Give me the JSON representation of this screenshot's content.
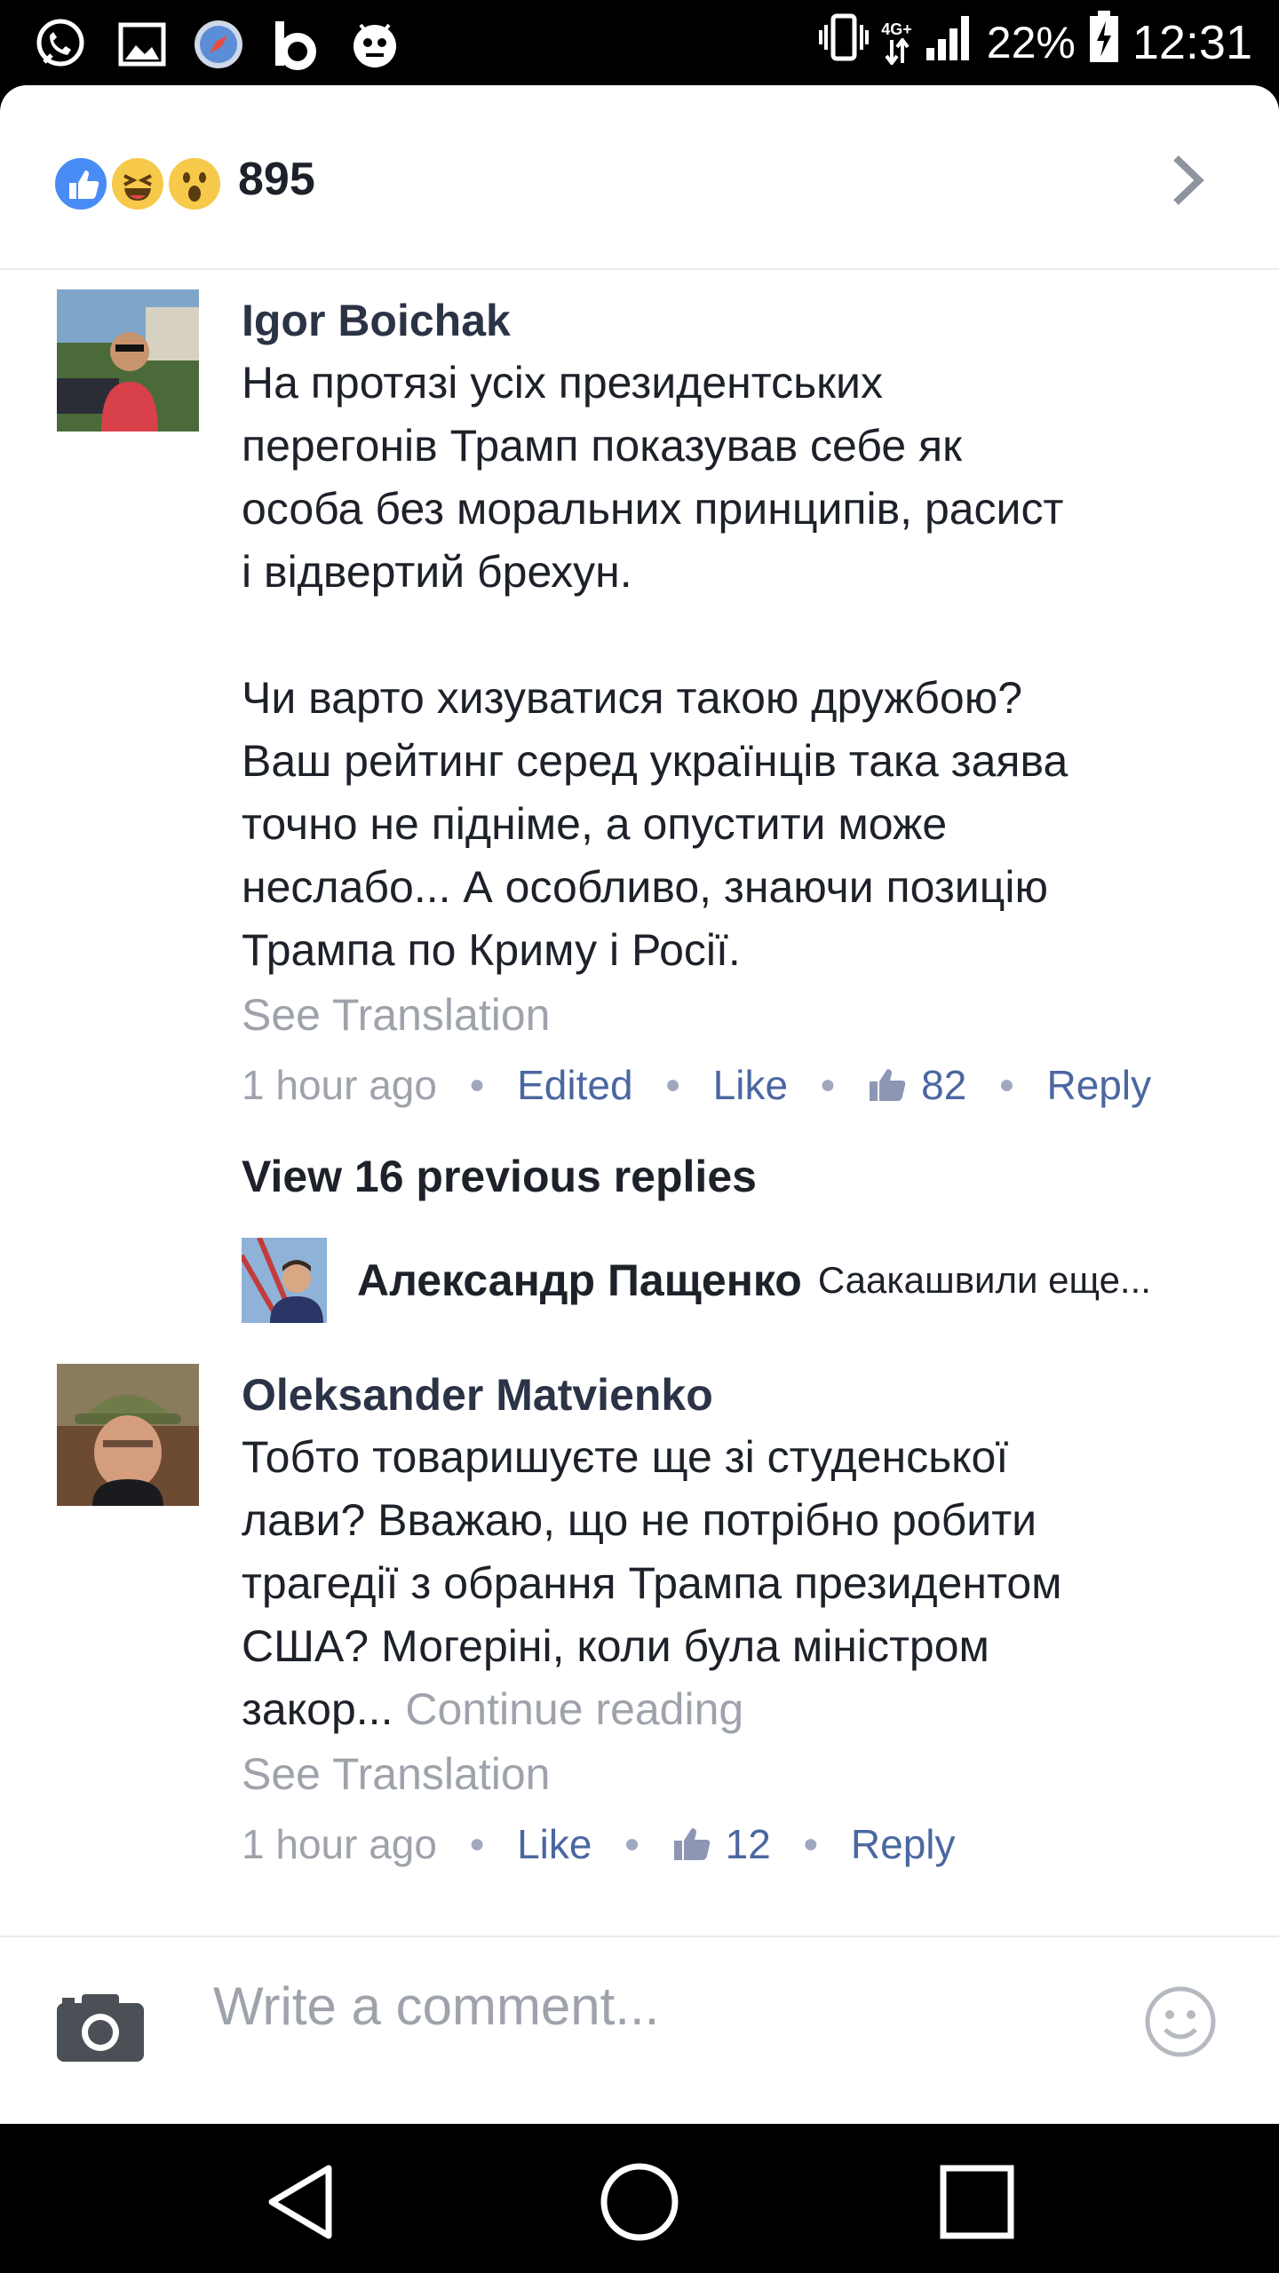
{
  "status_bar": {
    "icons": [
      "viber-icon",
      "gallery-icon",
      "browser-compass-icon",
      "b-app-icon",
      "security-bug-icon"
    ],
    "network": "4G+",
    "battery_percent": "22%",
    "time": "12:31"
  },
  "reactions": {
    "types": [
      "like",
      "haha",
      "wow"
    ],
    "count": "895"
  },
  "comments": [
    {
      "author": "Igor Boichak",
      "text": "На протязі усіх президентських\nперегонів Трамп показував себе як\nособа без моральних принципів, расист\nі відвертий брехун.\n\nЧи варто хизуватися такою дружбою?\nВаш рейтинг серед українців така заява\nточно не підніме, а опустити може\nнеслабо... А особливо, знаючи позицію\nТрампа по Криму і Росії.",
      "see_translation": "See Translation",
      "time": "1 hour ago",
      "edited": "Edited",
      "like_label": "Like",
      "like_count": "82",
      "reply_label": "Reply"
    },
    {
      "author": "Oleksander Matvienko",
      "text": "Тобто товаришуєте ще зі студенської\nлави? Вважаю, що не потрібно робити\nтрагедії з обрання Трампа президентом\nСША? Могеріні, коли була міністром\nзакор...",
      "continue_reading": "Continue reading",
      "see_translation": "See Translation",
      "time": "1 hour ago",
      "like_label": "Like",
      "like_count": "12",
      "reply_label": "Reply"
    }
  ],
  "replies": {
    "view_previous": "View 16 previous replies",
    "last_reply": {
      "author": "Александр Пащенко",
      "snippet": "Саакашвили еще..."
    }
  },
  "composer": {
    "placeholder": "Write a comment..."
  },
  "colors": {
    "link_blue": "#4b67a1",
    "name_dark": "#2b3346",
    "muted_gray": "#9ea3ab",
    "like_blue": "#4a8cf5",
    "emoji_yellow": "#f7c94a"
  }
}
